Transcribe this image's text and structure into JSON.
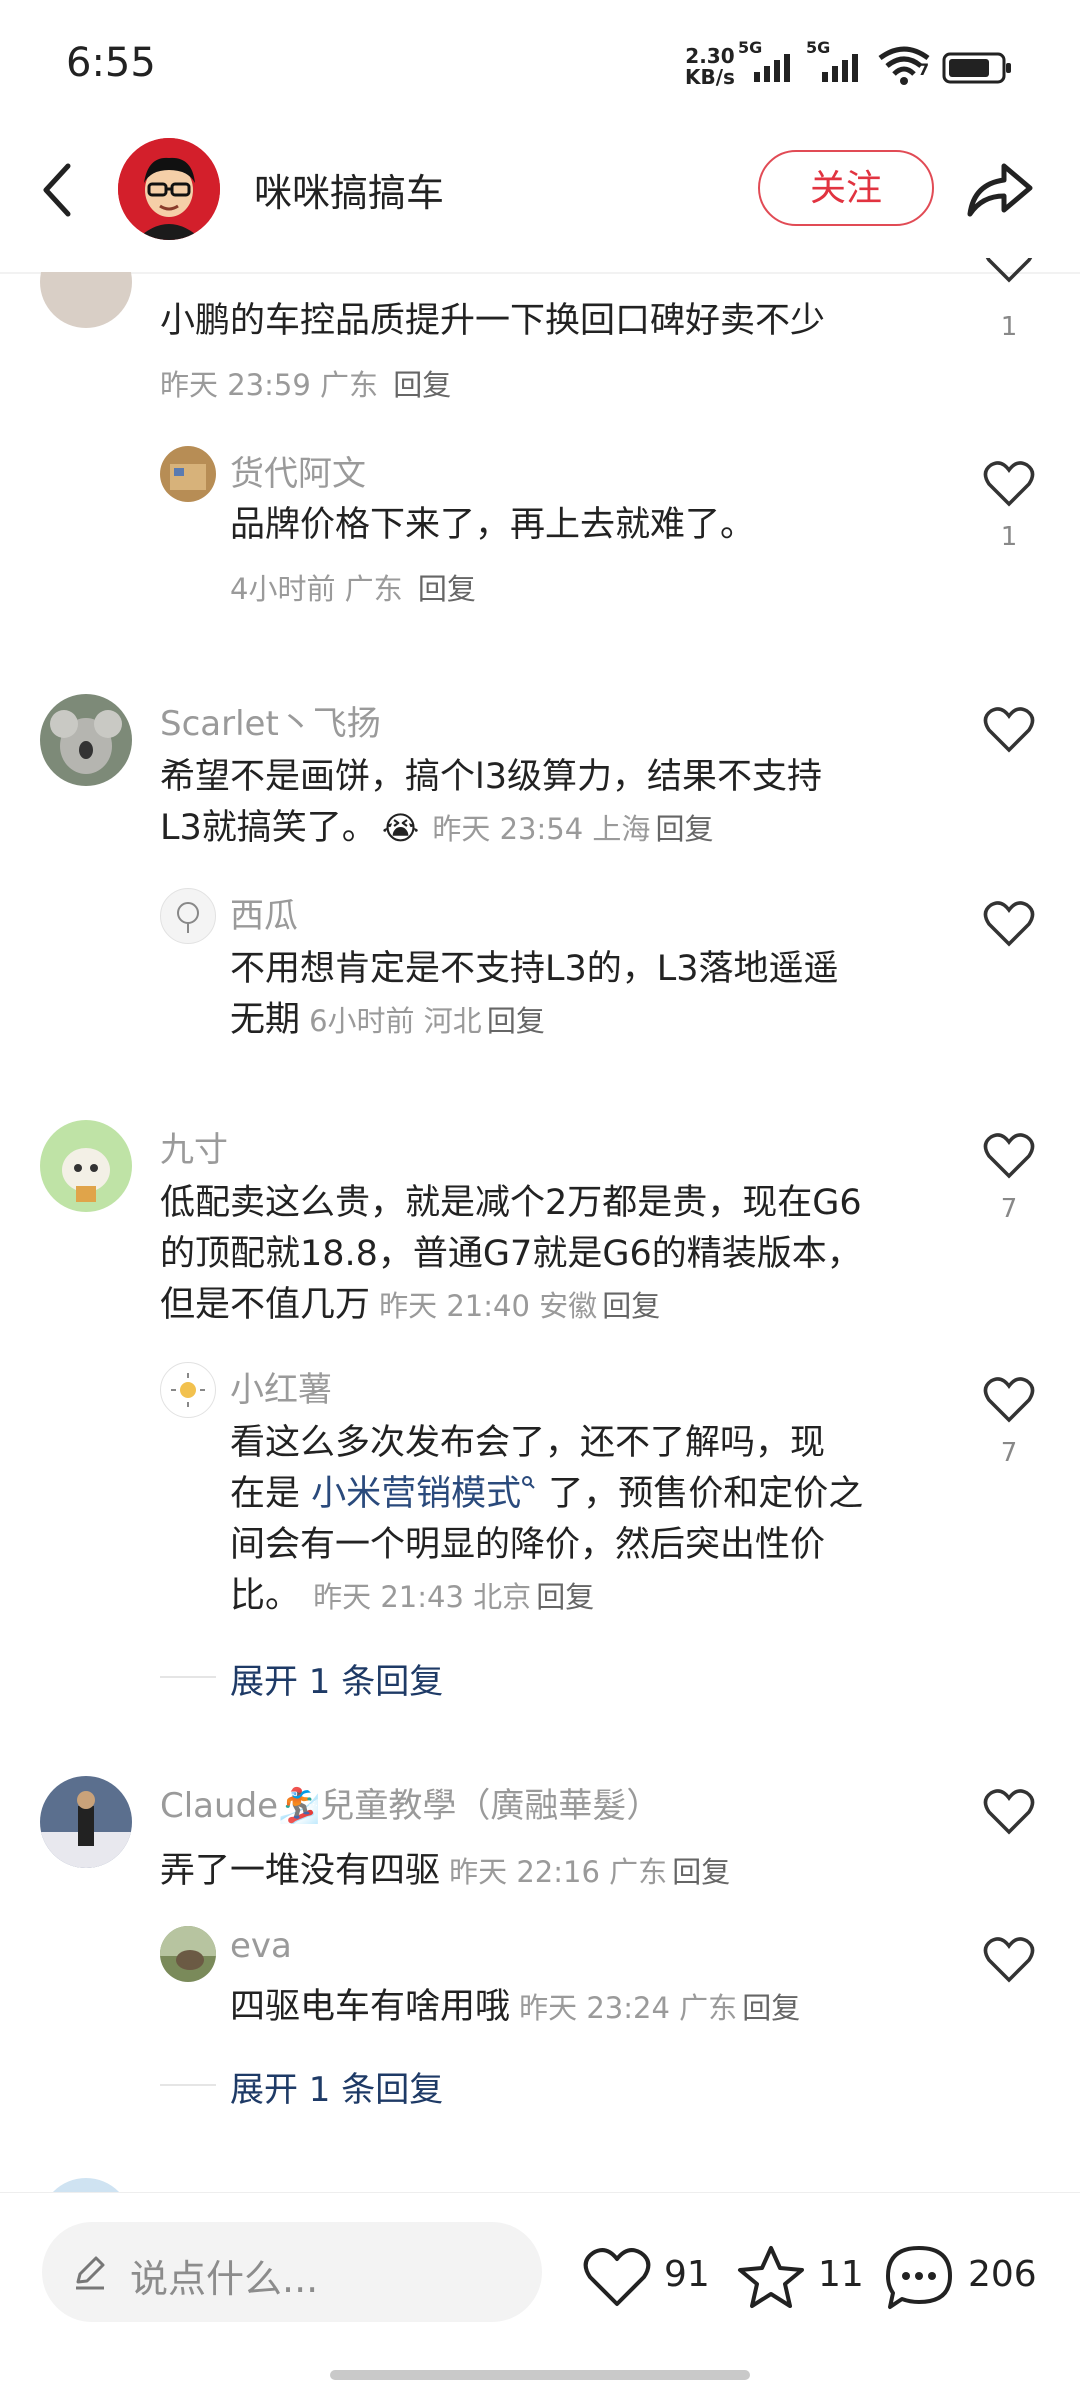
{
  "status_bar": {
    "time": "6:55",
    "net_speed_value": "2.30",
    "net_speed_unit": "KB/s",
    "sim1": "5G",
    "sim2": "5G",
    "wifi_badge": "7"
  },
  "header": {
    "author_name": "咪咪搞搞车",
    "follow_label": "关注"
  },
  "comments": [
    {
      "name": "",
      "text": "小鹏的车控品质提升一下换回口碑好卖不少",
      "meta": "昨天 23:59 广东",
      "reply_label": "回复",
      "likes": "1",
      "replies": [
        {
          "name": "货代阿文",
          "text": "品牌价格下来了，再上去就难了。",
          "meta": "4小时前 广东",
          "reply_label": "回复",
          "likes": "1"
        }
      ]
    },
    {
      "name": "Scarlet丶飞扬",
      "text_line1": "希望不是画饼，搞个l3级算力，结果不支持",
      "text_line2": "L3就搞笑了。",
      "emoji": "😭",
      "meta": "昨天 23:54 上海",
      "reply_label": "回复",
      "likes": "",
      "replies": [
        {
          "name": "西瓜",
          "text_line1": "不用想肯定是不支持L3的，L3落地遥遥",
          "text_line2": "无期",
          "meta": "6小时前 河北",
          "reply_label": "回复",
          "likes": ""
        }
      ]
    },
    {
      "name": "九寸",
      "text_line1": "低配卖这么贵，就是减个2万都是贵，现在G6",
      "text_line2": "的顶配就18.8，普通G7就是G6的精装版本，",
      "text_line3": "但是不值几万",
      "meta": "昨天 21:40 安徽",
      "reply_label": "回复",
      "likes": "7",
      "replies": [
        {
          "name": "小红薯",
          "text_line1": "看这么多次发布会了，还不了解吗，现",
          "text_line2_pre": "在是 ",
          "text_line2_link": "小米营销模式",
          "text_line2_post": " 了，预售价和定价之",
          "text_line3": "间会有一个明显的降价，然后突出性价",
          "text_line4": "比。",
          "meta": "昨天 21:43 北京",
          "reply_label": "回复",
          "likes": "7"
        }
      ],
      "expand_label": "展开 1 条回复"
    },
    {
      "name": "Claude🏂兒童教學（廣融華髮）",
      "text": "弄了一堆没有四驱",
      "meta": "昨天 22:16 广东",
      "reply_label": "回复",
      "likes": "",
      "replies": [
        {
          "name": "eva",
          "text": "四驱电车有啥用哦",
          "meta": "昨天 23:24 广东",
          "reply_label": "回复",
          "likes": ""
        }
      ],
      "expand_label": "展开 1 条回复"
    }
  ],
  "bottom_bar": {
    "input_placeholder": "说点什么...",
    "likes_count": "91",
    "favorites_count": "11",
    "comments_count": "206"
  },
  "colors": {
    "accent_red": "#e13340",
    "link_blue": "#2a4a7c",
    "meta_gray": "#9a9a9a"
  }
}
